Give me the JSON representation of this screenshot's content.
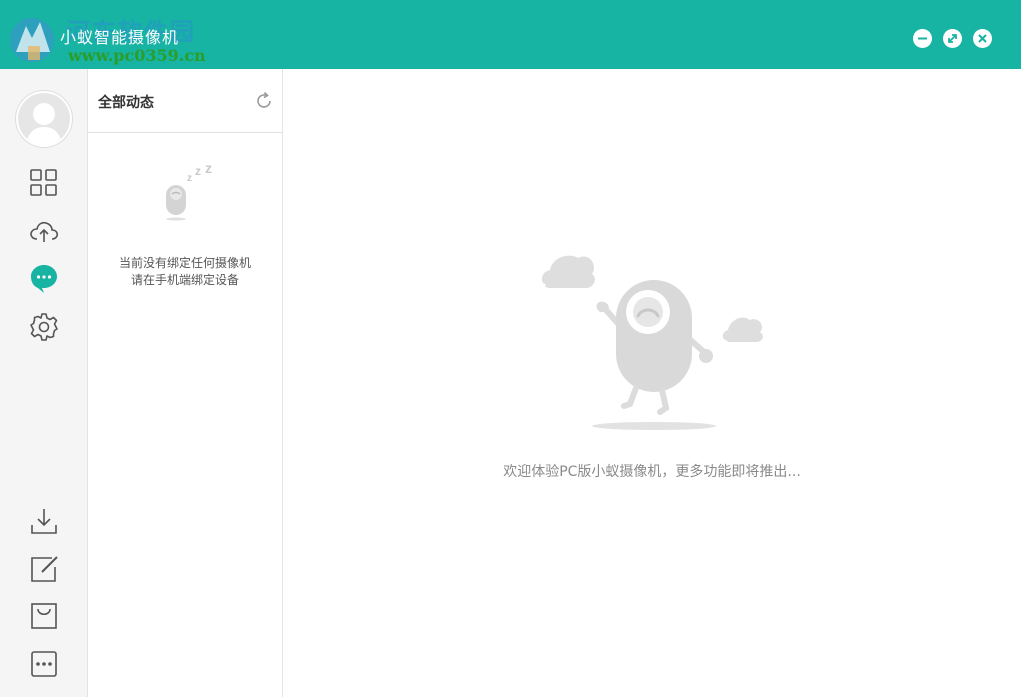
{
  "window": {
    "title": "小蚁智能摄像机",
    "watermark_site": "河东软件园",
    "watermark_url": "www.pc0359.cn",
    "accent_color": "#17b3a3",
    "controls": [
      "minimize-icon",
      "maximize-icon",
      "close-icon"
    ]
  },
  "sidebar": {
    "top_items": [
      {
        "name": "avatar",
        "icon": "user-avatar"
      },
      {
        "name": "devices",
        "icon": "grid-icon"
      },
      {
        "name": "cloud",
        "icon": "cloud-upload-icon"
      },
      {
        "name": "messages",
        "icon": "chat-bubble-icon",
        "active": true
      },
      {
        "name": "settings",
        "icon": "gear-icon"
      }
    ],
    "bottom_items": [
      {
        "name": "download",
        "icon": "download-icon"
      },
      {
        "name": "edit",
        "icon": "edit-icon"
      },
      {
        "name": "shop",
        "icon": "shopping-bag-icon"
      },
      {
        "name": "more",
        "icon": "more-icon"
      }
    ]
  },
  "feed": {
    "title": "全部动态",
    "refresh_icon": "refresh-icon",
    "empty_line1": "当前没有绑定任何摄像机",
    "empty_line2": "请在手机端绑定设备"
  },
  "main": {
    "welcome": "欢迎体验PC版小蚁摄像机，更多功能即将推出..."
  }
}
